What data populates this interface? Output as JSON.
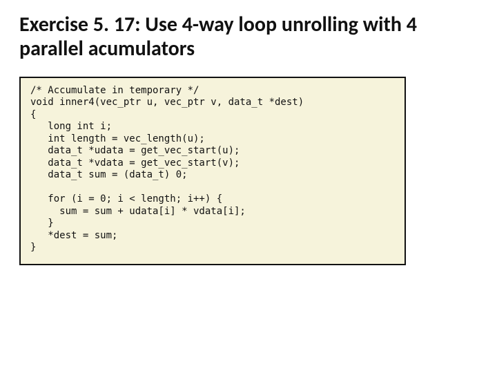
{
  "title": "Exercise 5. 17: Use 4-way loop unrolling with 4 parallel acumulators",
  "code": "/* Accumulate in temporary */\nvoid inner4(vec_ptr u, vec_ptr v, data_t *dest)\n{\n   long int i;\n   int length = vec_length(u);\n   data_t *udata = get_vec_start(u);\n   data_t *vdata = get_vec_start(v);\n   data_t sum = (data_t) 0;\n\n   for (i = 0; i < length; i++) {\n     sum = sum + udata[i] * vdata[i];\n   }\n   *dest = sum;\n}"
}
